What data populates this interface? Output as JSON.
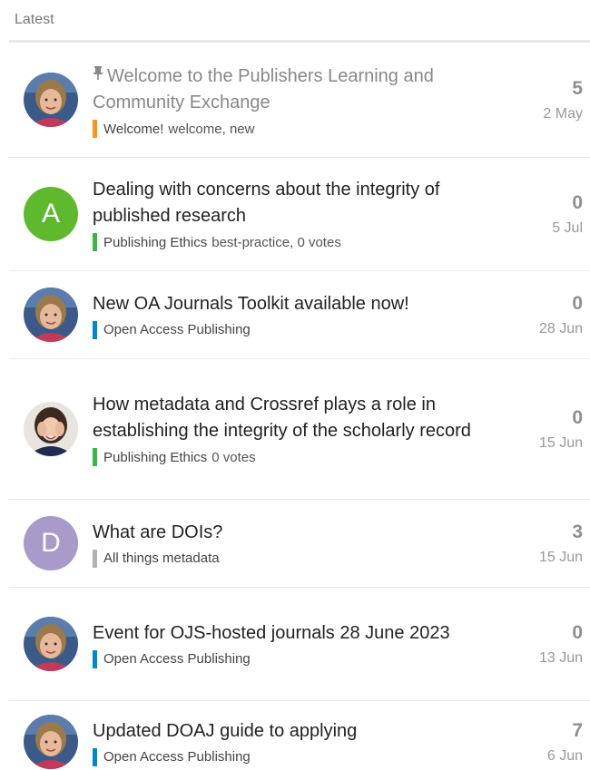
{
  "header": {
    "title": "Latest"
  },
  "topics": [
    {
      "title": "Welcome to the Publishers Learning and Community Exchange",
      "pinned": true,
      "category": "Welcome!",
      "category_color": "#f7941d",
      "tags": "welcome, new",
      "votes": "",
      "replies": "5",
      "date": "2 May",
      "avatar": "photo-woman-short-hair"
    },
    {
      "title": "Dealing with concerns about the integrity of published research",
      "pinned": false,
      "category": "Publishing Ethics",
      "category_color": "#3ab54a",
      "tags": "best-practice,",
      "votes": "0 votes",
      "replies": "0",
      "date": "5 Jul",
      "avatar_letter": "A",
      "avatar_color": "#5eb92d"
    },
    {
      "title": "New OA Journals Toolkit available now!",
      "pinned": false,
      "category": "Open Access Publishing",
      "category_color": "#0088cc",
      "tags": "",
      "votes": "",
      "replies": "0",
      "date": "28 Jun",
      "avatar": "photo-woman-short-hair"
    },
    {
      "title": "How metadata and Crossref plays a role in establishing the integrity of the scholarly record",
      "pinned": false,
      "category": "Publishing Ethics",
      "category_color": "#3ab54a",
      "tags": "",
      "votes": "0 votes",
      "replies": "0",
      "date": "15 Jun",
      "avatar": "photo-woman-hands-face"
    },
    {
      "title": "What are DOIs?",
      "pinned": false,
      "category": "All things metadata",
      "category_color": "#b3b3b3",
      "tags": "",
      "votes": "",
      "replies": "3",
      "date": "15 Jun",
      "avatar_letter": "D",
      "avatar_color": "#a89ac9"
    },
    {
      "title": "Event for OJS-hosted journals 28 June 2023",
      "pinned": false,
      "category": "Open Access Publishing",
      "category_color": "#0088cc",
      "tags": "",
      "votes": "",
      "replies": "0",
      "date": "13 Jun",
      "avatar": "photo-woman-short-hair"
    },
    {
      "title": "Updated DOAJ guide to applying",
      "pinned": false,
      "category": "Open Access Publishing",
      "category_color": "#0088cc",
      "tags": "",
      "votes": "",
      "replies": "7",
      "date": "6 Jun",
      "avatar": "photo-woman-short-hair"
    }
  ]
}
